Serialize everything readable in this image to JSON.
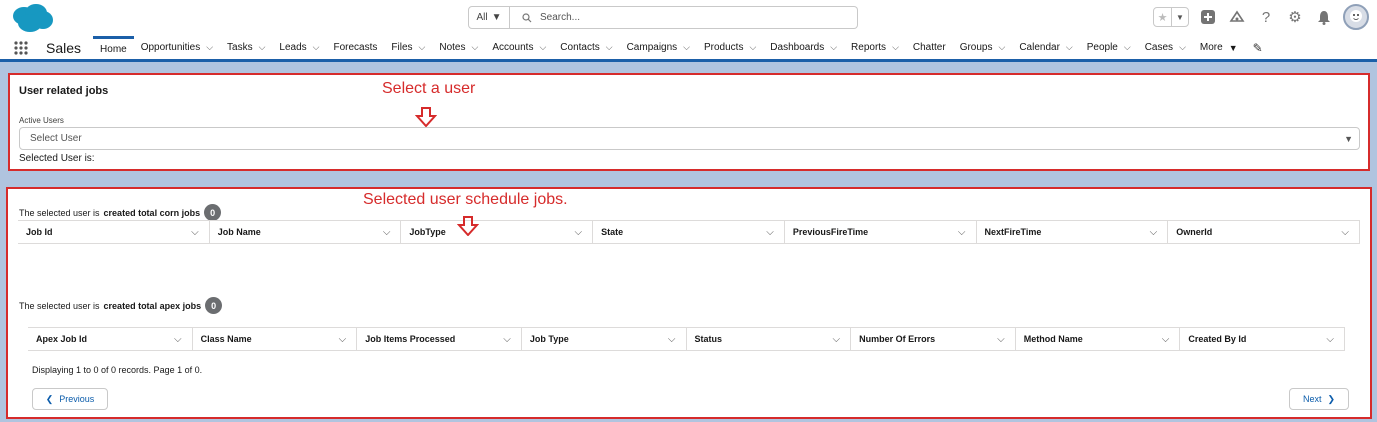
{
  "header": {
    "search_scope": "All",
    "search_placeholder": "Search..."
  },
  "nav": {
    "app_name": "Sales",
    "items": [
      {
        "label": "Home",
        "chevron": false,
        "active": true
      },
      {
        "label": "Opportunities",
        "chevron": true
      },
      {
        "label": "Tasks",
        "chevron": true
      },
      {
        "label": "Leads",
        "chevron": true
      },
      {
        "label": "Forecasts",
        "chevron": false
      },
      {
        "label": "Files",
        "chevron": true
      },
      {
        "label": "Notes",
        "chevron": true
      },
      {
        "label": "Accounts",
        "chevron": true
      },
      {
        "label": "Contacts",
        "chevron": true
      },
      {
        "label": "Campaigns",
        "chevron": true
      },
      {
        "label": "Products",
        "chevron": true
      },
      {
        "label": "Dashboards",
        "chevron": true
      },
      {
        "label": "Reports",
        "chevron": true
      },
      {
        "label": "Chatter",
        "chevron": false
      },
      {
        "label": "Groups",
        "chevron": true
      },
      {
        "label": "Calendar",
        "chevron": true
      },
      {
        "label": "People",
        "chevron": true
      },
      {
        "label": "Cases",
        "chevron": true
      }
    ],
    "more_label": "More"
  },
  "user_panel": {
    "title": "User related jobs",
    "annotation": "Select a user",
    "field_label": "Active Users",
    "select_placeholder": "Select User",
    "selected_user_text": "Selected User is:"
  },
  "jobs_panel": {
    "annotation": "Selected user schedule jobs.",
    "cron_prefix": "The selected user is",
    "cron_bold": "created total corn jobs",
    "cron_count": "0",
    "cron_columns": [
      "Job Id",
      "Job Name",
      "JobType",
      "State",
      "PreviousFireTime",
      "NextFireTime",
      "OwnerId"
    ],
    "apex_prefix": "The selected user is",
    "apex_bold": "created total apex jobs",
    "apex_count": "0",
    "apex_columns": [
      "Apex Job Id",
      "Class Name",
      "Job Items Processed",
      "Job Type",
      "Status",
      "Number Of Errors",
      "Method Name",
      "Created By Id"
    ],
    "displaying_text": "Displaying 1 to 0 of 0 records. Page 1 of 0.",
    "previous_label": "Previous",
    "next_label": "Next"
  },
  "colors": {
    "accent": "#1b5fa8",
    "annotation_red": "#d62b2b",
    "background": "#b0c4df"
  }
}
